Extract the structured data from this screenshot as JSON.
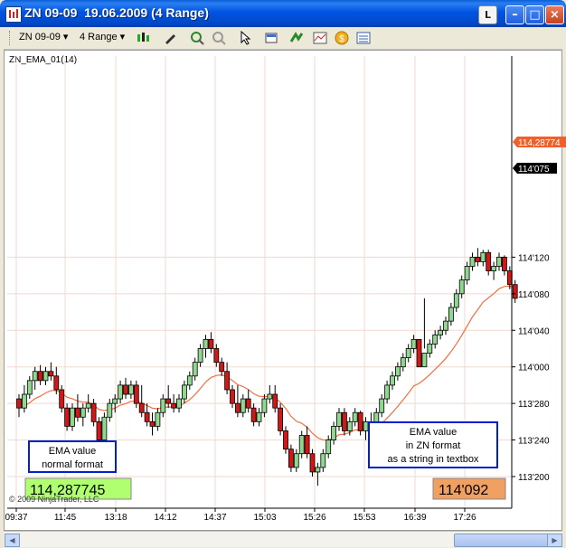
{
  "window": {
    "title": "ZN 09-09  19.06.2009 (4 Range)",
    "l_button": "L"
  },
  "toolbar": {
    "instrument": "ZN 09-09 ▾",
    "period": "4 Range ▾"
  },
  "indicator_label": "ZN_EMA_01(14)",
  "copyright": "© 2009 NinjaTrader, LLC",
  "annotations": {
    "left_box": [
      "EMA value",
      "normal format"
    ],
    "right_box": [
      "EMA value",
      "in ZN format",
      "as a string in textbox"
    ],
    "left_value": "114,287745",
    "right_value": "114'092"
  },
  "price_axis": {
    "ticks": [
      "114'120",
      "114'080",
      "114'040",
      "114'000",
      "113'280",
      "113'240",
      "113'200"
    ],
    "ema_marker": "114,28774",
    "last_marker": "114'075"
  },
  "colors": {
    "up": "#90d890",
    "down": "#d01818",
    "ema": "#f07040",
    "ema_marker_bg": "#f0602a",
    "last_marker_bg": "#000000",
    "box_border": "#0020d0",
    "left_value_bg": "#b0ff70",
    "right_value_bg": "#f0a060"
  },
  "chart_data": {
    "type": "candlestick",
    "time_ticks": [
      "09:37",
      "11:45",
      "13:18",
      "14:12",
      "14:37",
      "15:03",
      "15:26",
      "15:53",
      "16:39",
      "17:26"
    ],
    "bars": [
      [
        113.285,
        113.29,
        113.265,
        113.275
      ],
      [
        113.275,
        113.3,
        113.27,
        113.29
      ],
      [
        113.29,
        113.31,
        113.285,
        113.305
      ],
      [
        113.305,
        113.32,
        113.295,
        113.315
      ],
      [
        113.315,
        113.322,
        113.3,
        113.305
      ],
      [
        113.305,
        113.32,
        113.3,
        113.315
      ],
      [
        113.315,
        113.325,
        113.305,
        113.31
      ],
      [
        113.31,
        113.32,
        113.29,
        113.295
      ],
      [
        113.295,
        113.3,
        113.27,
        113.275
      ],
      [
        113.275,
        113.28,
        113.25,
        113.255
      ],
      [
        113.255,
        113.28,
        113.25,
        113.275
      ],
      [
        113.275,
        113.29,
        113.26,
        113.265
      ],
      [
        113.265,
        113.28,
        113.255,
        113.275
      ],
      [
        113.275,
        113.29,
        113.27,
        113.28
      ],
      [
        113.28,
        113.285,
        113.255,
        113.26
      ],
      [
        113.26,
        113.265,
        113.235,
        113.24
      ],
      [
        113.24,
        113.27,
        113.235,
        113.265
      ],
      [
        113.265,
        113.285,
        113.26,
        113.28
      ],
      [
        113.28,
        113.29,
        113.27,
        113.285
      ],
      [
        113.285,
        113.305,
        113.28,
        113.3
      ],
      [
        113.3,
        113.308,
        113.285,
        113.29
      ],
      [
        113.29,
        113.305,
        113.285,
        113.3
      ],
      [
        113.3,
        113.305,
        113.275,
        113.28
      ],
      [
        113.28,
        113.3,
        113.265,
        113.27
      ],
      [
        113.27,
        113.28,
        113.255,
        113.26
      ],
      [
        113.26,
        113.27,
        113.245,
        113.255
      ],
      [
        113.255,
        113.275,
        113.25,
        113.27
      ],
      [
        113.27,
        113.29,
        113.265,
        113.285
      ],
      [
        113.285,
        113.3,
        113.275,
        113.28
      ],
      [
        113.28,
        113.29,
        113.27,
        113.275
      ],
      [
        113.275,
        113.29,
        113.27,
        113.285
      ],
      [
        113.285,
        113.305,
        113.28,
        113.3
      ],
      [
        113.3,
        113.315,
        113.295,
        113.31
      ],
      [
        113.31,
        113.33,
        113.305,
        113.325
      ],
      [
        113.325,
        113.345,
        113.32,
        113.34
      ],
      [
        113.34,
        113.355,
        113.33,
        113.35
      ],
      [
        113.35,
        113.358,
        113.335,
        113.34
      ],
      [
        113.34,
        113.345,
        113.32,
        113.325
      ],
      [
        113.325,
        113.33,
        113.31,
        113.315
      ],
      [
        113.315,
        113.325,
        113.29,
        113.295
      ],
      [
        113.295,
        113.3,
        113.275,
        113.28
      ],
      [
        113.28,
        113.3,
        113.265,
        113.27
      ],
      [
        113.27,
        113.29,
        113.265,
        113.285
      ],
      [
        113.285,
        113.295,
        113.27,
        113.275
      ],
      [
        113.275,
        113.28,
        113.255,
        113.26
      ],
      [
        113.26,
        113.275,
        113.255,
        113.27
      ],
      [
        113.27,
        113.29,
        113.265,
        113.285
      ],
      [
        113.285,
        113.3,
        113.28,
        113.29
      ],
      [
        113.29,
        113.3,
        113.27,
        113.275
      ],
      [
        113.275,
        113.28,
        113.245,
        113.25
      ],
      [
        113.25,
        113.255,
        113.225,
        113.23
      ],
      [
        113.23,
        113.235,
        113.205,
        113.21
      ],
      [
        113.21,
        113.23,
        113.205,
        113.225
      ],
      [
        113.225,
        113.25,
        113.22,
        113.245
      ],
      [
        113.245,
        113.255,
        113.22,
        113.225
      ],
      [
        113.225,
        113.23,
        113.2,
        113.205
      ],
      [
        113.205,
        113.215,
        113.19,
        113.21
      ],
      [
        113.21,
        113.23,
        113.205,
        113.225
      ],
      [
        113.225,
        113.245,
        113.22,
        113.24
      ],
      [
        113.24,
        113.26,
        113.235,
        113.255
      ],
      [
        113.255,
        113.275,
        113.25,
        113.27
      ],
      [
        113.27,
        113.275,
        113.245,
        113.25
      ],
      [
        113.25,
        113.265,
        113.245,
        113.26
      ],
      [
        113.26,
        113.275,
        113.255,
        113.27
      ],
      [
        113.27,
        113.272,
        113.245,
        113.25
      ],
      [
        113.25,
        113.265,
        113.24,
        113.26
      ],
      [
        113.26,
        113.27,
        113.245,
        113.25
      ],
      [
        113.25,
        113.275,
        113.245,
        113.27
      ],
      [
        113.27,
        113.29,
        113.265,
        113.285
      ],
      [
        113.285,
        113.305,
        113.28,
        113.3
      ],
      [
        113.3,
        113.315,
        113.295,
        113.31
      ],
      [
        113.31,
        113.325,
        113.305,
        113.32
      ],
      [
        113.32,
        113.335,
        113.315,
        113.33
      ],
      [
        113.33,
        113.345,
        113.325,
        113.34
      ],
      [
        113.34,
        113.355,
        113.335,
        113.35
      ],
      [
        113.35,
        114.005,
        113.345,
        114.0
      ],
      [
        114.0,
        114.02,
        113.395,
        114.015
      ],
      [
        114.015,
        114.03,
        114.01,
        114.025
      ],
      [
        114.025,
        114.04,
        114.02,
        114.035
      ],
      [
        114.035,
        114.045,
        114.03,
        114.04
      ],
      [
        114.04,
        114.055,
        114.035,
        114.05
      ],
      [
        114.05,
        114.07,
        114.045,
        114.065
      ],
      [
        114.065,
        114.085,
        114.06,
        114.08
      ],
      [
        114.08,
        114.1,
        114.075,
        114.095
      ],
      [
        114.095,
        114.115,
        114.09,
        114.11
      ],
      [
        114.11,
        114.125,
        114.105,
        114.12
      ],
      [
        114.12,
        114.13,
        114.11,
        114.115
      ],
      [
        114.115,
        114.128,
        114.11,
        114.125
      ],
      [
        114.125,
        114.128,
        114.1,
        114.105
      ],
      [
        114.105,
        114.115,
        114.095,
        114.11
      ],
      [
        114.11,
        114.125,
        114.105,
        114.12
      ],
      [
        114.12,
        114.122,
        114.1,
        114.105
      ],
      [
        114.105,
        114.11,
        114.085,
        114.09
      ],
      [
        114.09,
        114.095,
        114.07,
        114.075
      ]
    ],
    "ema_period": 14
  }
}
